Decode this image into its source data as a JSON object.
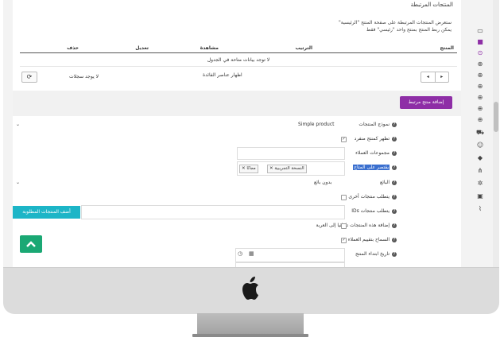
{
  "panel": {
    "title": "المنتجات المرتبطة"
  },
  "notes": {
    "line1": "ستعرض المنتجات المرتبطة على صفحة المنتج \"الرئيسية\"",
    "line2": "يمكن ربط المنتج بمنتج واحد \"رئيسي\" فقط"
  },
  "table": {
    "headers": [
      "المنتج",
      "الترتيب",
      "مشاهدة",
      "تعديل",
      "حذف"
    ],
    "empty_text": "لا توجد بيانات متاحة في الجدول",
    "none_text": "لا يوجد سجلات",
    "visible_text": "اظهار عناصر الفائدة",
    "refresh_icon": "⟳",
    "prev_label": "◂",
    "next_label": "▸"
  },
  "add_button": {
    "label": "إضافة منتج مرتبط"
  },
  "form": {
    "product_type": {
      "label": "نموذج المنتجات",
      "value": "Simple product"
    },
    "single_product": {
      "label": "تظهر كمنتج منفرد",
      "checked": "✓"
    },
    "customer_groups": {
      "label": "مجموعات العملاء"
    },
    "restrict_customers": {
      "label": "يقتصر على المتاح",
      "tags": [
        "النسخة التجريبية",
        "مجانًا"
      ],
      "tag_remove": "✕"
    },
    "seller": {
      "label": "البائع",
      "value": "بدون بائع"
    },
    "requires_other": {
      "label": "يتطلب منتجات أخرى"
    },
    "required_ids": {
      "label": "يتطلب منتجات IDs",
      "button": "أضف المنتجات المطلوبة"
    },
    "auto_add_cart": {
      "label": "إضافة هذه المنتجات تلقائيا إلى العربة"
    },
    "allow_reviews": {
      "label": "السماح بتقييم العملاء",
      "checked": "✓"
    },
    "start_date": {
      "label": "تاريخ ابتداء المنتج"
    }
  },
  "scroll_top": {
    "icon": "⌃"
  },
  "sidebar_icons": [
    "monitor-icon",
    "chat-icon",
    "circle-plus-icon",
    "circle-plus-icon",
    "circle-plus-icon",
    "circle-plus-icon",
    "circle-plus-icon",
    "circle-plus-icon",
    "circle-plus-icon",
    "cart-icon",
    "user-icon",
    "tag-icon",
    "share-icon",
    "gear-icon",
    "box-icon",
    "chart-icon"
  ],
  "colors": {
    "accent": "#8e2ea6",
    "teal": "#1cb5c7",
    "green": "#1aa874",
    "highlight": "#3a6fcf"
  }
}
